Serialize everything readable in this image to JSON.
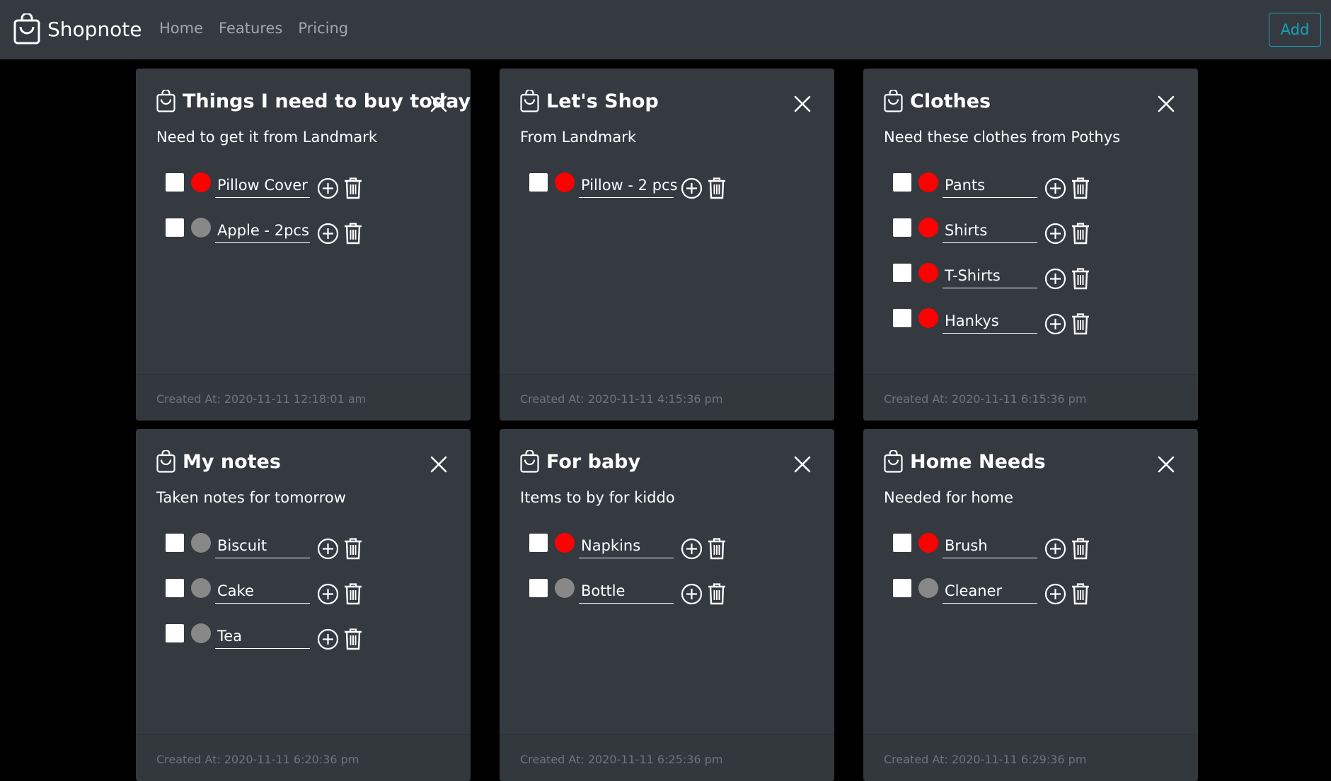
{
  "brand": {
    "name": "Shopnote",
    "icon": "shopping-bag-icon"
  },
  "nav": {
    "links": [
      "Home",
      "Features",
      "Pricing"
    ],
    "add_label": "Add"
  },
  "colors": {
    "navbar": "#343a40",
    "card": "#343a40",
    "accent": "#17a2b8",
    "high_priority": "#ff0000",
    "normal_priority": "#888888"
  },
  "notes": [
    {
      "title": "Things I need to buy today",
      "description": "Need to get it from Landmark",
      "items": [
        {
          "name": "Pillow Cover",
          "priority": "high"
        },
        {
          "name": "Apple - 2pcs",
          "priority": "normal"
        }
      ],
      "created_at": "Created At: 2020-11-11 12:18:01 am"
    },
    {
      "title": "Let's Shop",
      "description": "From Landmark",
      "items": [
        {
          "name": "Pillow - 2 pcs",
          "priority": "high"
        }
      ],
      "created_at": "Created At: 2020-11-11 4:15:36 pm"
    },
    {
      "title": "Clothes",
      "description": "Need these clothes from Pothys",
      "items": [
        {
          "name": "Pants",
          "priority": "high"
        },
        {
          "name": "Shirts",
          "priority": "high"
        },
        {
          "name": "T-Shirts",
          "priority": "high"
        },
        {
          "name": "Hankys",
          "priority": "high"
        }
      ],
      "created_at": "Created At: 2020-11-11 6:15:36 pm"
    },
    {
      "title": "My notes",
      "description": "Taken notes for tomorrow",
      "items": [
        {
          "name": "Biscuit",
          "priority": "normal"
        },
        {
          "name": "Cake",
          "priority": "normal"
        },
        {
          "name": "Tea",
          "priority": "normal"
        }
      ],
      "created_at": "Created At: 2020-11-11 6:20:36 pm"
    },
    {
      "title": "For baby",
      "description": "Items to by for kiddo",
      "items": [
        {
          "name": "Napkins",
          "priority": "high"
        },
        {
          "name": "Bottle",
          "priority": "normal"
        }
      ],
      "created_at": "Created At: 2020-11-11 6:25:36 pm"
    },
    {
      "title": "Home Needs",
      "description": "Needed for home",
      "items": [
        {
          "name": "Brush",
          "priority": "high"
        },
        {
          "name": "Cleaner",
          "priority": "normal"
        }
      ],
      "created_at": "Created At: 2020-11-11 6:29:36 pm"
    }
  ]
}
